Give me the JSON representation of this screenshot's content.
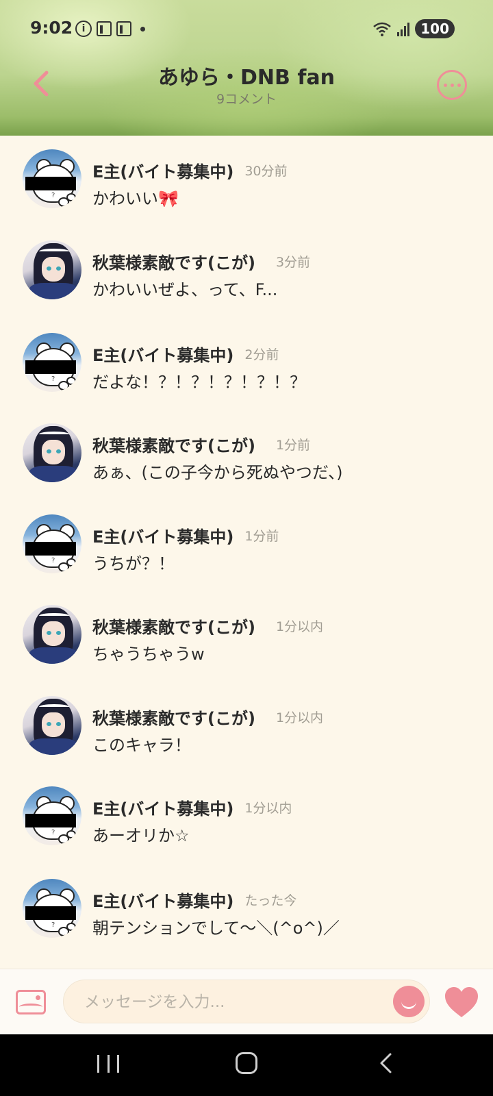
{
  "status_bar": {
    "time": "9:02",
    "battery": "100",
    "icons": [
      "info-icon",
      "news-icon",
      "news-icon",
      "dot-icon",
      "wifi-icon",
      "signal-icon",
      "battery-icon"
    ]
  },
  "header": {
    "title": "あゆら・DNB fan",
    "subtitle": "9コメント",
    "back_icon": "chevron-left-icon",
    "more_icon": "more-icon"
  },
  "comments": [
    {
      "author": "E主(バイト募集中)",
      "avatar": "e",
      "time": "30分前",
      "text": "かわいい",
      "emoji": "🎀"
    },
    {
      "author": "秋葉様素敵です(こが)",
      "avatar": "a",
      "time": "3分前",
      "text": "かわいいぜよ、って、F..."
    },
    {
      "author": "E主(バイト募集中)",
      "avatar": "e",
      "time": "2分前",
      "text": "だよな！？！？！？！？！？"
    },
    {
      "author": "秋葉様素敵です(こが)",
      "avatar": "a",
      "time": "1分前",
      "text": "あぁ、(この子今から死ぬやつだ、)"
    },
    {
      "author": "E主(バイト募集中)",
      "avatar": "e",
      "time": "1分前",
      "text": "うちが？！"
    },
    {
      "author": "秋葉様素敵です(こが)",
      "avatar": "a",
      "time": "1分以内",
      "text": "ちゃうちゃうw"
    },
    {
      "author": "秋葉様素敵です(こが)",
      "avatar": "a",
      "time": "1分以内",
      "text": "このキャラ！"
    },
    {
      "author": "E主(バイト募集中)",
      "avatar": "e",
      "time": "1分以内",
      "text": "あーオリか☆"
    },
    {
      "author": "E主(バイト募集中)",
      "avatar": "e",
      "time": "たった今",
      "text": "朝テンションでして〜＼(^o^)／"
    }
  ],
  "input_bar": {
    "placeholder": "メッセージを入力...",
    "accent_color": "#ef8e98"
  },
  "colors": {
    "background": "#fdf7ea",
    "accent": "#ef8e98"
  }
}
